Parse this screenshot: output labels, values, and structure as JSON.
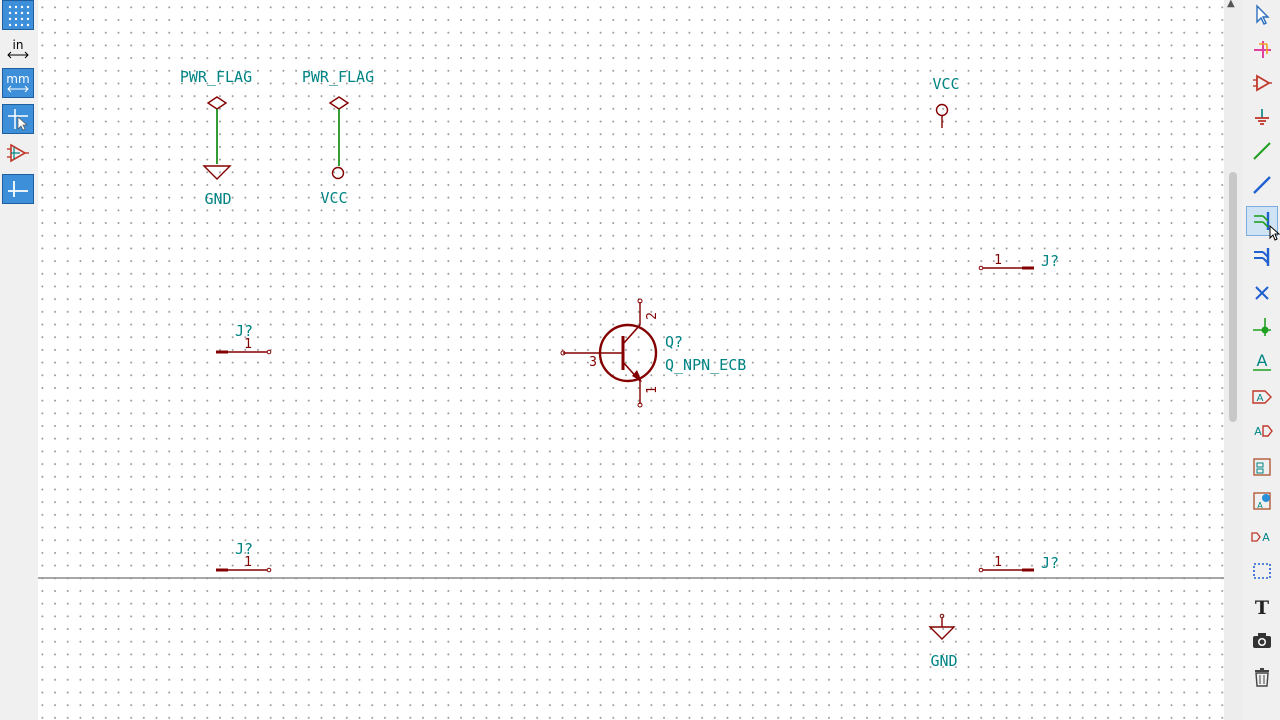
{
  "left_toolbar": {
    "units_in": "in",
    "units_mm": "mm"
  },
  "schematic": {
    "pwr_flag_1": "PWR_FLAG",
    "pwr_flag_2": "PWR_FLAG",
    "gnd_top": "GND",
    "vcc_left": "VCC",
    "vcc_right": "VCC",
    "gnd_bottom": "GND",
    "transistor_ref": "Q?",
    "transistor_value": "Q_NPN_ECB",
    "transistor_pin_e": "2",
    "transistor_pin_b": "3",
    "transistor_pin_c": "1",
    "conn_left_top_ref": "J?",
    "conn_left_top_pin": "1",
    "conn_left_bottom_ref": "J?",
    "conn_left_bottom_pin": "1",
    "conn_right_top_ref": "J?",
    "conn_right_top_pin": "1",
    "conn_right_bottom_ref": "J?",
    "conn_right_bottom_pin": "1"
  },
  "right_toolbar": {
    "text_tool_glyph": "T",
    "label_tool_glyph": "A"
  }
}
